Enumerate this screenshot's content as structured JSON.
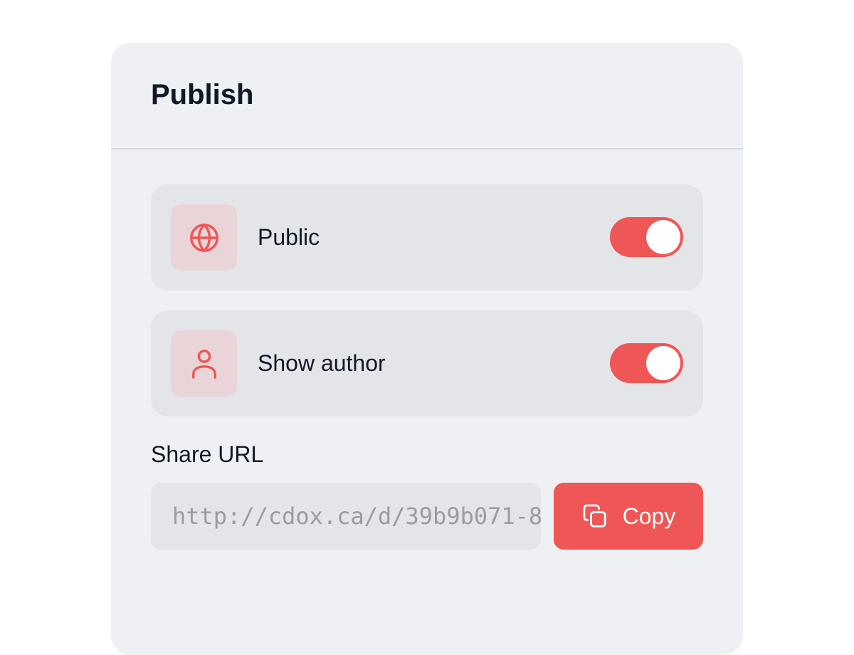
{
  "panel": {
    "title": "Publish"
  },
  "settings": [
    {
      "label": "Public",
      "icon": "globe-icon",
      "enabled": true
    },
    {
      "label": "Show author",
      "icon": "user-icon",
      "enabled": true
    }
  ],
  "share": {
    "label": "Share URL",
    "url": "http://cdox.ca/d/39b9b071-8",
    "copy_label": "Copy",
    "copy_icon": "copy-icon"
  },
  "colors": {
    "accent": "#ef5656",
    "panel_bg": "#eef0f4",
    "row_bg": "#e4e5e9",
    "icon_tile_bg": "#e9d5d8"
  }
}
